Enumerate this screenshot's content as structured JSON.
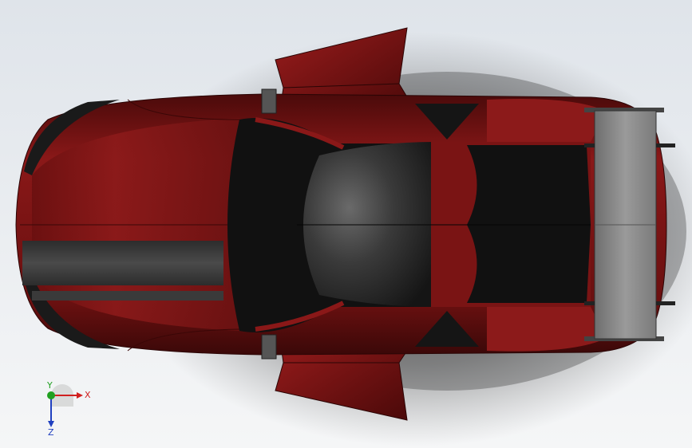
{
  "viewport": {
    "background_top": "#dfe4ea",
    "background_bottom": "#f5f6f7"
  },
  "model": {
    "body_color": "#7a1414",
    "body_highlight": "#a42323",
    "stripe_color": "#3d3d3d",
    "glass_color": "#141414",
    "wing_color": "#8a8a8a"
  },
  "triad": {
    "x_label": "X",
    "y_label": "Y",
    "z_label": "Z",
    "x_color": "#d02020",
    "y_color": "#20a020",
    "z_color": "#2040c0"
  }
}
